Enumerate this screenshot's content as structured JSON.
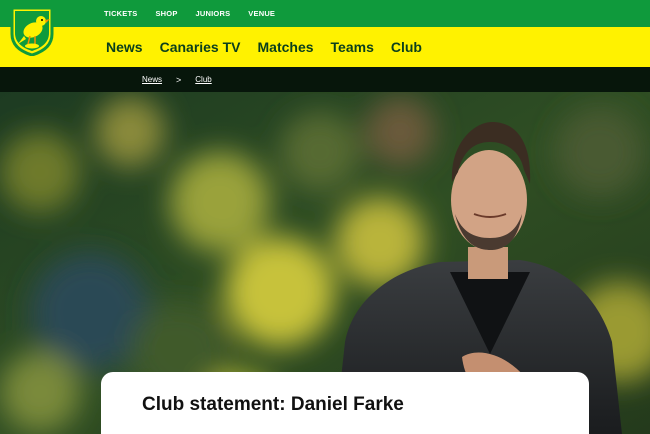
{
  "utility_nav": {
    "items": [
      "TICKETS",
      "SHOP",
      "JUNIORS",
      "VENUE"
    ]
  },
  "main_nav": {
    "items": [
      "News",
      "Canaries TV",
      "Matches",
      "Teams",
      "Club"
    ]
  },
  "breadcrumb": {
    "items": [
      "News",
      "Club"
    ],
    "separator": ">"
  },
  "article": {
    "title": "Club statement: Daniel Farke"
  },
  "colors": {
    "green": "#0f9a3c",
    "yellow": "#fff200",
    "dark": "#07160b"
  },
  "hero": {
    "image": "man-in-dark-jacket-hand-on-chest-stadium-crowd"
  }
}
